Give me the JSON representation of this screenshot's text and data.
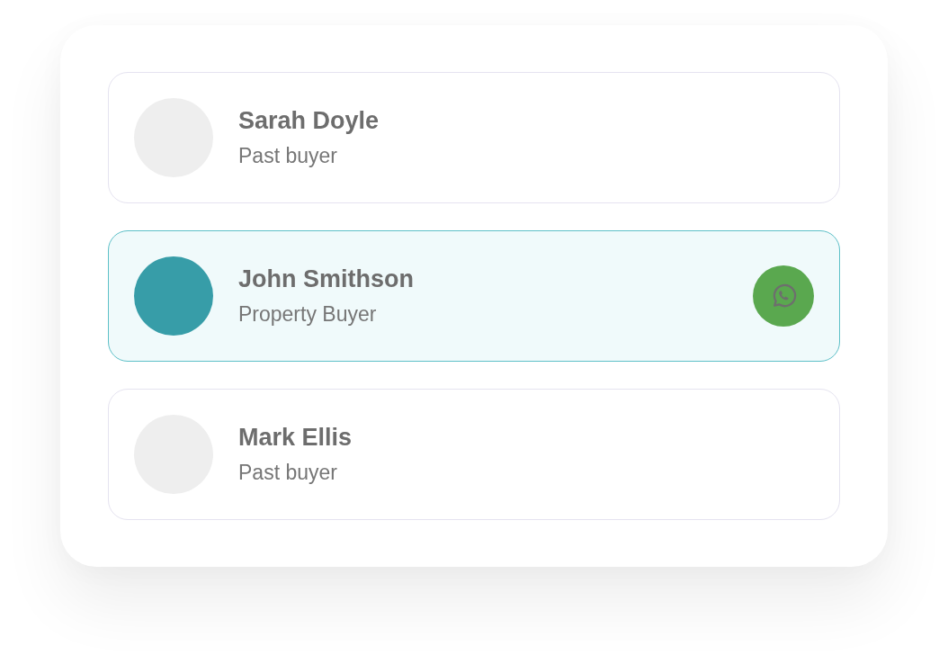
{
  "contacts": [
    {
      "name": "Sarah Doyle",
      "role": "Past buyer",
      "selected": false
    },
    {
      "name": "John Smithson",
      "role": "Property Buyer",
      "selected": true
    },
    {
      "name": "Mark Ellis",
      "role": "Past buyer",
      "selected": false
    }
  ]
}
